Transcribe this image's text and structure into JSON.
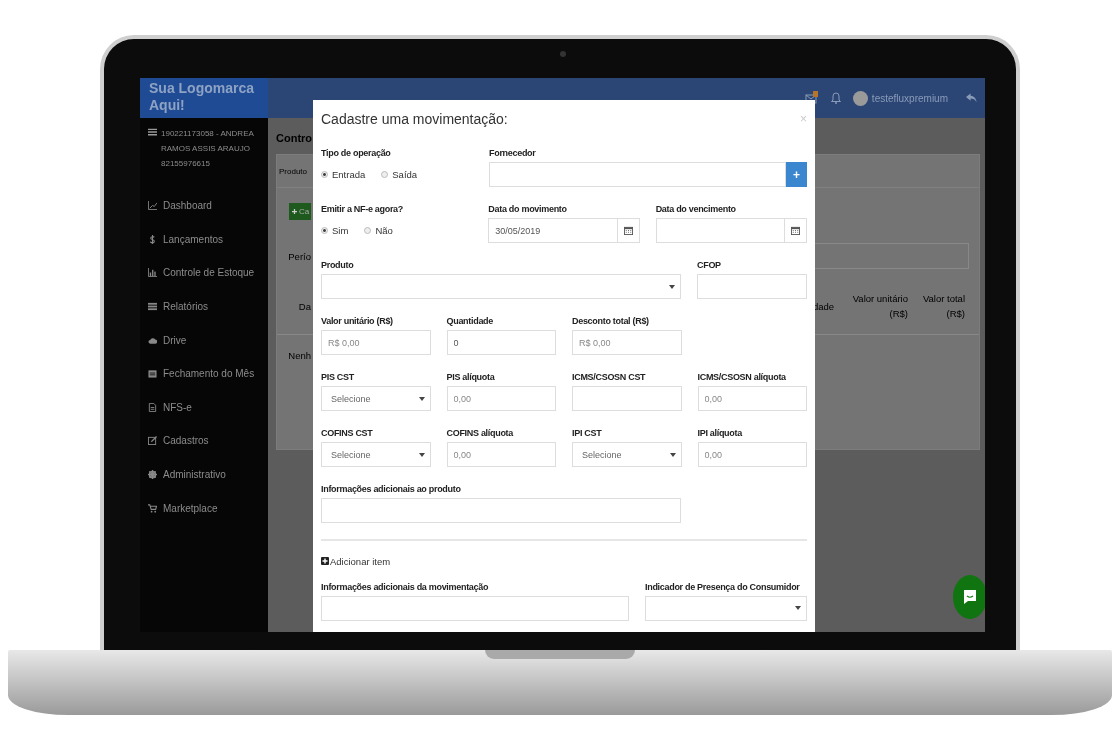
{
  "header": {
    "logo": "Sua Logomarca Aqui!",
    "user": "testefluxpremium"
  },
  "sidebar": {
    "account": "190221173058 - ANDREA RAMOS ASSIS ARAUJO 82155976615",
    "items": [
      {
        "label": "Dashboard",
        "kind": "chart"
      },
      {
        "label": "Lançamentos",
        "kind": "dollar"
      },
      {
        "label": "Controle de Estoque",
        "kind": "bars"
      },
      {
        "label": "Relatórios",
        "kind": "list"
      },
      {
        "label": "Drive",
        "kind": "cloud"
      },
      {
        "label": "Fechamento do Mês",
        "kind": "calendar"
      },
      {
        "label": "NFS-e",
        "kind": "file"
      },
      {
        "label": "Cadastros",
        "kind": "edit"
      },
      {
        "label": "Administrativo",
        "kind": "gear"
      },
      {
        "label": "Marketplace",
        "kind": "cart"
      }
    ]
  },
  "page": {
    "title": "Contro",
    "tab": "Produto",
    "new_button": "Ca",
    "period_label": "Perío",
    "column_1": "Da",
    "column_2": "dade",
    "column_3": "Valor unitário (R$)",
    "column_4": "Valor total (R$)",
    "empty_message": "Nenh"
  },
  "modal": {
    "title": "Cadastre uma movimentação:",
    "close": "×",
    "rows": [
      [
        {
          "kind": "radio",
          "label": "Tipo de operação",
          "options": [
            {
              "label": "Entrada",
              "selected": true
            },
            {
              "label": "Saída",
              "selected": false
            }
          ]
        },
        {
          "kind": "input-add",
          "label": "Fornecedor",
          "button": "+"
        }
      ],
      [
        {
          "kind": "radio",
          "label": "Emitir a NF-e agora?",
          "options": [
            {
              "label": "Sim",
              "selected": true
            },
            {
              "label": "Não",
              "selected": false
            }
          ]
        },
        {
          "kind": "date",
          "label": "Data do movimento",
          "value": "30/05/2019"
        },
        {
          "kind": "date",
          "label": "Data do vencimento"
        }
      ],
      [
        {
          "kind": "select",
          "label": "Produto"
        },
        {
          "kind": "input",
          "label": "CFOP"
        }
      ],
      [
        {
          "kind": "input",
          "label": "Valor unitário (R$)",
          "placeholder": "R$ 0,00"
        },
        {
          "kind": "input",
          "label": "Quantidade",
          "value": "0"
        },
        {
          "kind": "input",
          "label": "Desconto total (R$)",
          "placeholder": "R$ 0,00"
        }
      ],
      [
        {
          "kind": "select",
          "label": "PIS CST",
          "value": "Selecione"
        },
        {
          "kind": "input",
          "label": "PIS alíquota",
          "placeholder": "0,00"
        },
        {
          "kind": "input",
          "label": "ICMS/CSOSN CST"
        },
        {
          "kind": "input",
          "label": "ICMS/CSOSN alíquota",
          "placeholder": "0,00"
        }
      ],
      [
        {
          "kind": "select",
          "label": "COFINS CST",
          "value": "Selecione"
        },
        {
          "kind": "input",
          "label": "COFINS alíquota",
          "placeholder": "0,00"
        },
        {
          "kind": "select",
          "label": "IPI CST",
          "value": "Selecione"
        },
        {
          "kind": "input",
          "label": "IPI alíquota",
          "placeholder": "0,00"
        }
      ],
      [
        {
          "kind": "input",
          "label": "Informações adicionais ao produto"
        }
      ]
    ],
    "add_item": "Adicionar item",
    "footer_row": [
      {
        "kind": "input",
        "label": "Informações adicionais da movimentação"
      },
      {
        "kind": "select",
        "label": "Indicador de Presença do Consumidor"
      }
    ]
  }
}
